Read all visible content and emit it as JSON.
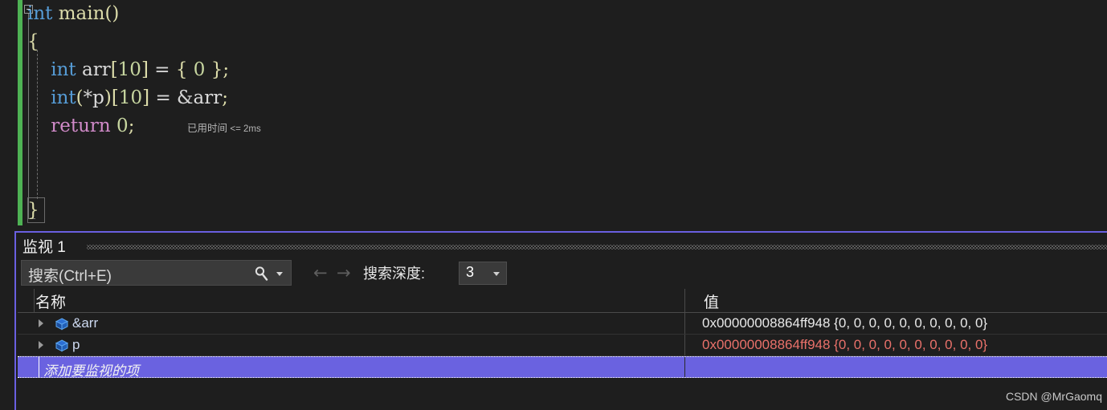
{
  "editor": {
    "fold_marker": "collapse-minus",
    "change_bar_color": "#4eb254",
    "lines": [
      {
        "indent": 0,
        "tokens": [
          {
            "t": "int",
            "c": "kw"
          },
          {
            "t": " ",
            "c": "plain"
          },
          {
            "t": "main",
            "c": "fn"
          },
          {
            "t": "()",
            "c": "punct"
          }
        ]
      },
      {
        "indent": 0,
        "tokens": [
          {
            "t": "{",
            "c": "punct"
          }
        ]
      },
      {
        "indent": 0,
        "tokens": [
          {
            "t": "    ",
            "c": "plain"
          },
          {
            "t": "int",
            "c": "kw"
          },
          {
            "t": " ",
            "c": "plain"
          },
          {
            "t": "arr",
            "c": "ident"
          },
          {
            "t": "[",
            "c": "punct"
          },
          {
            "t": "10",
            "c": "num"
          },
          {
            "t": "]",
            "c": "punct"
          },
          {
            "t": " ",
            "c": "plain"
          },
          {
            "t": "=",
            "c": "op"
          },
          {
            "t": " ",
            "c": "plain"
          },
          {
            "t": "{",
            "c": "punct"
          },
          {
            "t": " ",
            "c": "plain"
          },
          {
            "t": "0",
            "c": "num"
          },
          {
            "t": " ",
            "c": "plain"
          },
          {
            "t": "}",
            "c": "punct"
          },
          {
            "t": ";",
            "c": "punct"
          }
        ]
      },
      {
        "indent": 0,
        "tokens": [
          {
            "t": "    ",
            "c": "plain"
          },
          {
            "t": "int",
            "c": "kw"
          },
          {
            "t": "(",
            "c": "punct"
          },
          {
            "t": "*",
            "c": "op"
          },
          {
            "t": "p",
            "c": "ident"
          },
          {
            "t": ")",
            "c": "punct"
          },
          {
            "t": "[",
            "c": "punct"
          },
          {
            "t": "10",
            "c": "num"
          },
          {
            "t": "]",
            "c": "punct"
          },
          {
            "t": " ",
            "c": "plain"
          },
          {
            "t": "=",
            "c": "op"
          },
          {
            "t": " ",
            "c": "plain"
          },
          {
            "t": "&",
            "c": "op"
          },
          {
            "t": "arr",
            "c": "ident"
          },
          {
            "t": ";",
            "c": "punct"
          }
        ]
      },
      {
        "indent": 0,
        "tokens": [
          {
            "t": "    ",
            "c": "plain"
          },
          {
            "t": "return",
            "c": "kwctl"
          },
          {
            "t": " ",
            "c": "plain"
          },
          {
            "t": "0",
            "c": "num"
          },
          {
            "t": ";",
            "c": "punct"
          }
        ]
      },
      {
        "indent": 0,
        "tokens": []
      },
      {
        "indent": 0,
        "tokens": []
      },
      {
        "indent": 0,
        "tokens": [
          {
            "t": "}",
            "c": "punct"
          }
        ]
      }
    ],
    "elapsed_label": "已用时间",
    "elapsed_value": "<= 2ms"
  },
  "watch": {
    "title": "监视 1",
    "search_placeholder": "搜索(Ctrl+E)",
    "search_value": "",
    "nav_back": "←",
    "nav_forward": "→",
    "depth_label": "搜索深度:",
    "depth_value": "3",
    "columns": {
      "name": "名称",
      "value": "值"
    },
    "rows": [
      {
        "name": "&arr",
        "value": "0x00000008864ff948 {0, 0, 0, 0, 0, 0, 0, 0, 0, 0}",
        "changed": false,
        "expandable": true
      },
      {
        "name": "p",
        "value": "0x00000008864ff948 {0, 0, 0, 0, 0, 0, 0, 0, 0, 0}",
        "changed": true,
        "expandable": true
      }
    ],
    "add_row_placeholder": "添加要监视的项",
    "selection_color": "#6a62e0",
    "border_color": "#6a5fe0",
    "changed_value_color": "#e9716a"
  },
  "watermark": "CSDN @MrGaomq"
}
